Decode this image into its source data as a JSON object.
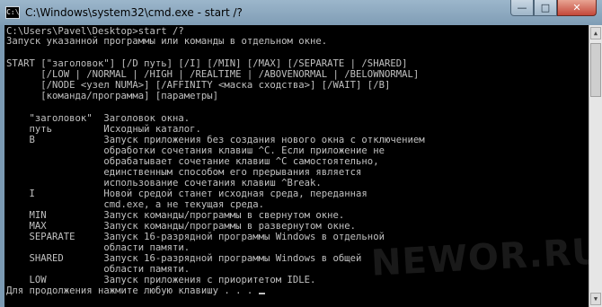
{
  "window": {
    "title": "C:\\Windows\\system32\\cmd.exe - start  /?",
    "icon_label": "C:\\",
    "controls": {
      "minimize": "—",
      "maximize": "□",
      "close": "✕"
    }
  },
  "console": {
    "lines": [
      "C:\\Users\\Pavel\\Desktop>start /?",
      "Запуск указанной программы или команды в отдельном окне.",
      "",
      "START [\"заголовок\"] [/D путь] [/I] [/MIN] [/MAX] [/SEPARATE | /SHARED]",
      "      [/LOW | /NORMAL | /HIGH | /REALTIME | /ABOVENORMAL | /BELOWNORMAL]",
      "      [/NODE <узел NUMA>] [/AFFINITY <маска сходства>] [/WAIT] [/B]",
      "      [команда/программа] [параметры]",
      "",
      "    \"заголовок\"  Заголовок окна.",
      "    путь         Исходный каталог.",
      "    B            Запуск приложения без создания нового окна с отключением",
      "                 обработки сочетания клавиш ^C. Если приложение не",
      "                 обрабатывает сочетание клавиш ^C самостоятельно,",
      "                 единственным способом его прерывания является",
      "                 использование сочетания клавиш ^Break.",
      "    I            Новой средой станет исходная среда, переданная",
      "                 cmd.exe, а не текущая среда.",
      "    MIN          Запуск команды/программы в свернутом окне.",
      "    MAX          Запуск команды/программы в развернутом окне.",
      "    SEPARATE     Запуск 16-разрядной программы Windows в отдельной",
      "                 области памяти.",
      "    SHARED       Запуск 16-разрядной программы Windows в общей",
      "                 области памяти.",
      "    LOW          Запуск приложения с приоритетом IDLE.",
      "Для продолжения нажмите любую клавишу . . ."
    ]
  },
  "watermark": "NEWOR.RU"
}
